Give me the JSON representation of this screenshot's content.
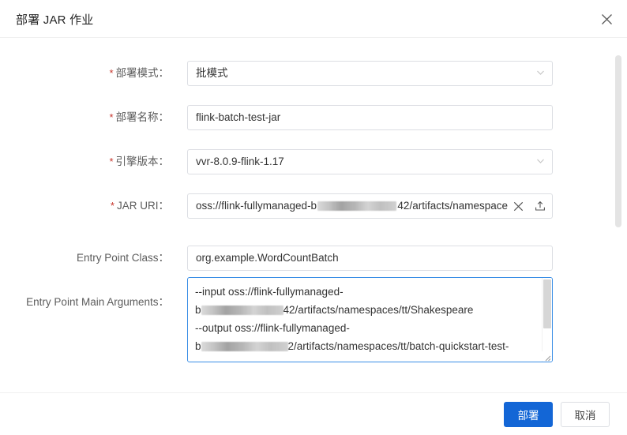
{
  "dialog": {
    "title": "部署 JAR 作业",
    "close_icon": "close-icon"
  },
  "form": {
    "rows": [
      {
        "label": "部署模式：",
        "required": true,
        "type": "select",
        "value": "批模式"
      },
      {
        "label": "部署名称：",
        "required": true,
        "type": "input",
        "value": "flink-batch-test-jar"
      },
      {
        "label": "引擎版本：",
        "required": true,
        "type": "select",
        "value": "vvr-8.0.9-flink-1.17"
      },
      {
        "label": "JAR URI：",
        "required": true,
        "type": "input-redacted",
        "value_prefix": "oss://flink-fullymanaged-b",
        "value_suffix": "42/artifacts/namespace"
      },
      {
        "label": "Entry Point Class：",
        "required": false,
        "type": "input",
        "value": "org.example.WordCountBatch"
      },
      {
        "label": "Entry Point Main Arguments：",
        "required": false,
        "type": "textarea",
        "lines": [
          {
            "text": "--input oss://flink-fullymanaged-"
          },
          {
            "prefix": "b",
            "suffix": "42/artifacts/namespaces/tt/Shakespeare"
          },
          {
            "text": "--output oss://flink-fullymanaged-"
          },
          {
            "prefix": "b",
            "suffix": "2/artifacts/namespaces/tt/batch-quickstart-test-"
          }
        ]
      }
    ]
  },
  "footer": {
    "deploy_label": "部署",
    "cancel_label": "取消"
  },
  "colors": {
    "primary": "#1366d6",
    "required_star": "#c7352c",
    "focus_border": "#3a8ee6"
  }
}
